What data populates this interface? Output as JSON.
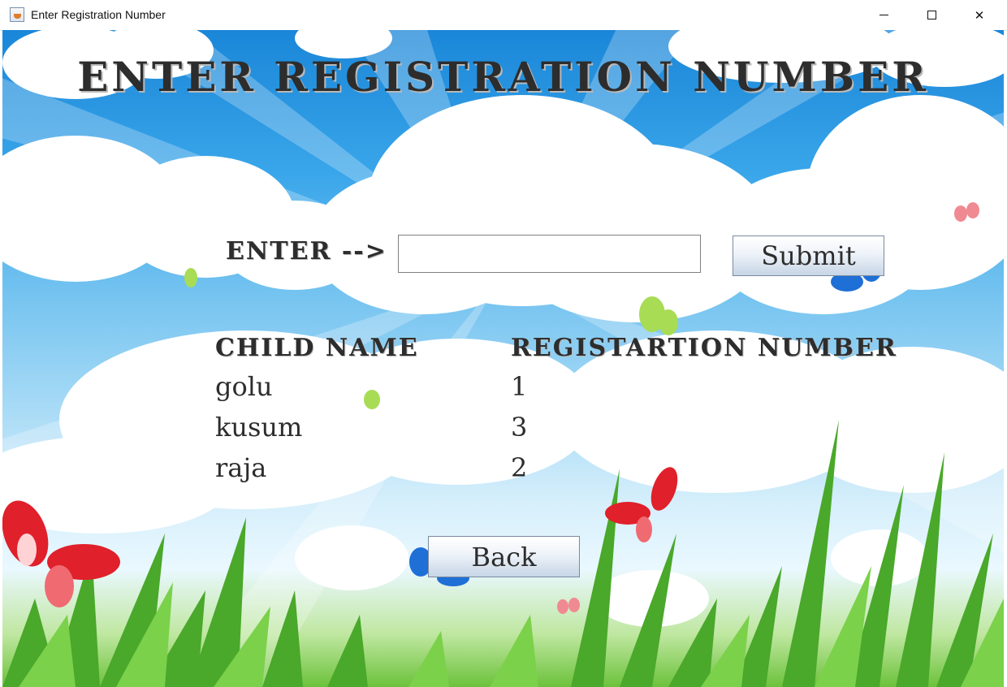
{
  "window": {
    "title": "Enter Registration Number"
  },
  "header": {
    "title": "ENTER REGISTRATION NUMBER"
  },
  "form": {
    "enter_label": "ENTER -->",
    "input_value": "",
    "submit_label": "Submit"
  },
  "table": {
    "headers": [
      "CHILD NAME",
      "REGISTARTION NUMBER"
    ],
    "rows": [
      [
        "golu",
        "1"
      ],
      [
        "kusum",
        "3"
      ],
      [
        "raja",
        "2"
      ]
    ]
  },
  "back_label": "Back",
  "colors": {
    "sky": "#2a96e0",
    "grass": "#5cb82c",
    "text": "#2d2d2d",
    "butterfly_red": "#e0202a",
    "butterfly_blue": "#1e6fd6",
    "butterfly_green": "#8fcf3a"
  }
}
